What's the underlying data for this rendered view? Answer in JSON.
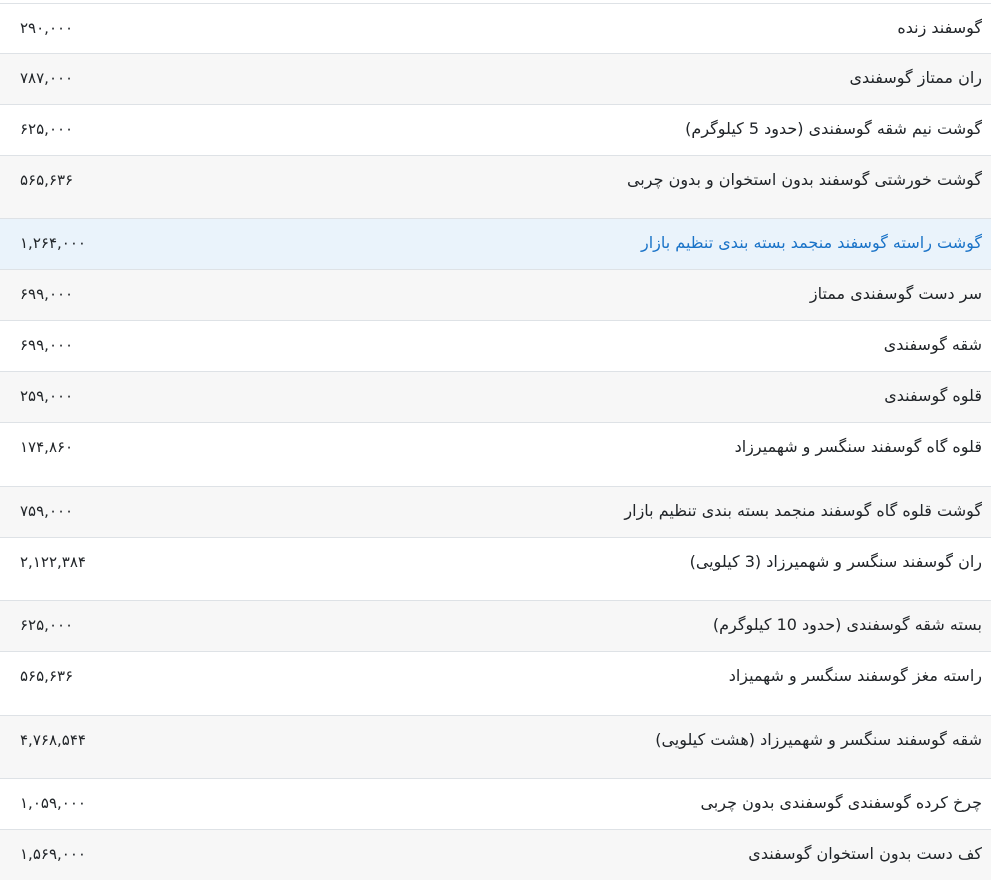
{
  "rows": [
    {
      "name": "گوسفند زنده",
      "price": "۲۹۰,۰۰۰",
      "height": 50,
      "style": "plain",
      "link": false
    },
    {
      "name": "ران ممتاز گوسفندی",
      "price": "۷۸۷,۰۰۰",
      "height": 51,
      "style": "striped",
      "link": false
    },
    {
      "name": "گوشت نیم شقه گوسفندی (حدود 5 کیلوگرم)",
      "price": "۶۲۵,۰۰۰",
      "height": 51,
      "style": "plain",
      "link": false
    },
    {
      "name": "گوشت خورشتی گوسفند بدون استخوان و بدون چربی",
      "price": "۵۶۵,۶۳۶",
      "height": 63,
      "style": "striped",
      "link": false
    },
    {
      "name": "گوشت راسته گوسفند منجمد بسته بندی تنظیم بازار",
      "price": "۱,۲۶۴,۰۰۰",
      "height": 51,
      "style": "highlight",
      "link": true
    },
    {
      "name": "سر دست گوسفندی ممتاز",
      "price": "۶۹۹,۰۰۰",
      "height": 51,
      "style": "striped",
      "link": false
    },
    {
      "name": "شقه گوسفندی",
      "price": "۶۹۹,۰۰۰",
      "height": 51,
      "style": "plain",
      "link": false
    },
    {
      "name": "قلوه گوسفندی",
      "price": "۲۵۹,۰۰۰",
      "height": 51,
      "style": "striped",
      "link": false
    },
    {
      "name": "قلوه گاه گوسفند سنگسر و شهمیرزاد",
      "price": "۱۷۴,۸۶۰",
      "height": 64,
      "style": "plain",
      "link": false
    },
    {
      "name": "گوشت قلوه گاه گوسفند منجمد بسته بندی تنظیم بازار",
      "price": "۷۵۹,۰۰۰",
      "height": 51,
      "style": "striped",
      "link": false
    },
    {
      "name": "ران گوسفند سنگسر و شهمیرزاد (3 کیلویی)",
      "price": "۲,۱۲۲,۳۸۴",
      "height": 63,
      "style": "plain",
      "link": false
    },
    {
      "name": "بسته شقه گوسفندی (حدود 10 کیلوگرم)",
      "price": "۶۲۵,۰۰۰",
      "height": 51,
      "style": "striped",
      "link": false
    },
    {
      "name": "راسته مغز گوسفند سنگسر و شهمیزاد",
      "price": "۵۶۵,۶۳۶",
      "height": 64,
      "style": "plain",
      "link": false
    },
    {
      "name": "شقه گوسفند سنگسر و شهمیرزاد (هشت کیلویی)",
      "price": "۴,۷۶۸,۵۴۴",
      "height": 63,
      "style": "striped",
      "link": false
    },
    {
      "name": "چرخ کرده گوسفندی گوسفندی بدون چربی",
      "price": "۱,۰۵۹,۰۰۰",
      "height": 51,
      "style": "plain",
      "link": false
    },
    {
      "name": "کف دست بدون استخوان گوسفندی",
      "price": "۱,۵۶۹,۰۰۰",
      "height": 51,
      "style": "striped",
      "link": false
    }
  ]
}
